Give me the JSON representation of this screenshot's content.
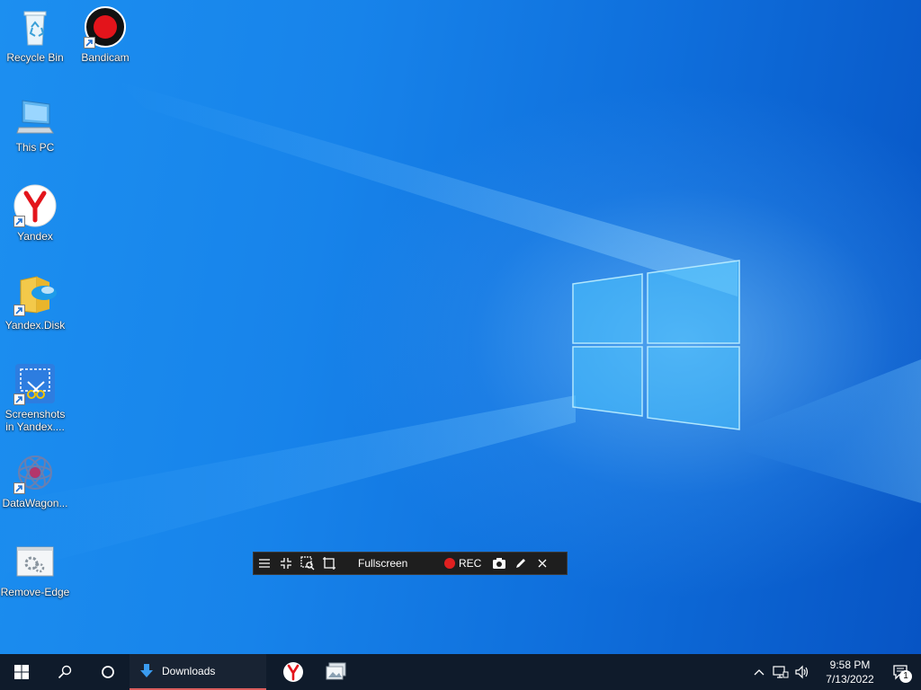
{
  "desktop": {
    "icons": [
      {
        "label": "Recycle Bin",
        "icon": "recycle-bin-icon"
      },
      {
        "label": "Bandicam",
        "icon": "bandicam-icon"
      },
      {
        "label": "This PC",
        "icon": "this-pc-icon"
      },
      {
        "label": "Yandex",
        "icon": "yandex-icon"
      },
      {
        "label": "Yandex.Disk",
        "icon": "yandex-disk-icon"
      },
      {
        "label": "Screenshots in Yandex....",
        "icon": "screenshots-icon"
      },
      {
        "label": "DataWagon...",
        "icon": "datawagon-icon"
      },
      {
        "label": "Remove-Edge",
        "icon": "remove-edge-icon"
      }
    ]
  },
  "bandicam": {
    "mode_label": "Fullscreen",
    "rec_label": "REC",
    "rec_color": "#e02020"
  },
  "taskbar": {
    "downloads_label": "Downloads",
    "clock": {
      "time": "9:58 PM",
      "date": "7/13/2022"
    },
    "notification_count": "1",
    "accent": "#d85c5c"
  }
}
